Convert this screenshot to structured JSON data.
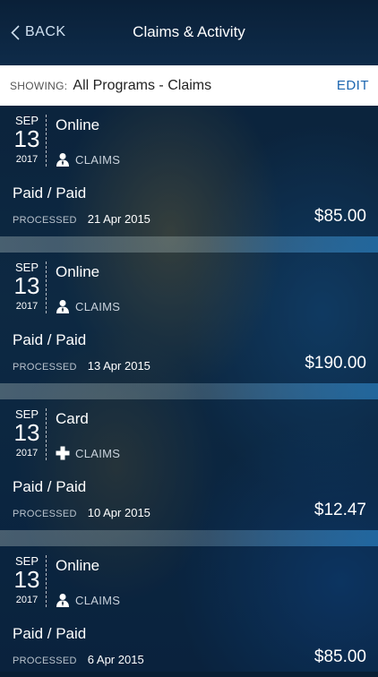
{
  "header": {
    "back_label": "BACK",
    "title": "Claims & Activity"
  },
  "filter": {
    "label": "SHOWING:",
    "value": "All Programs - Claims",
    "edit_label": "EDIT"
  },
  "claims": [
    {
      "month": "SEP",
      "day": "13",
      "year": "2017",
      "method": "Online",
      "category": "CLAIMS",
      "category_icon": "person-icon",
      "status": "Paid / Paid",
      "processed_label": "PROCESSED",
      "processed_date": "21 Apr 2015",
      "amount": "$85.00"
    },
    {
      "month": "SEP",
      "day": "13",
      "year": "2017",
      "method": "Online",
      "category": "CLAIMS",
      "category_icon": "person-icon",
      "status": "Paid / Paid",
      "processed_label": "PROCESSED",
      "processed_date": "13 Apr 2015",
      "amount": "$190.00"
    },
    {
      "month": "SEP",
      "day": "13",
      "year": "2017",
      "method": "Card",
      "category": "CLAIMS",
      "category_icon": "medical-cross-icon",
      "status": "Paid / Paid",
      "processed_label": "PROCESSED",
      "processed_date": "10 Apr 2015",
      "amount": "$12.47"
    },
    {
      "month": "SEP",
      "day": "13",
      "year": "2017",
      "method": "Online",
      "category": "CLAIMS",
      "category_icon": "person-icon",
      "status": "Paid / Paid",
      "processed_label": "PROCESSED",
      "processed_date": "6 Apr 2015",
      "amount": "$85.00"
    }
  ]
}
